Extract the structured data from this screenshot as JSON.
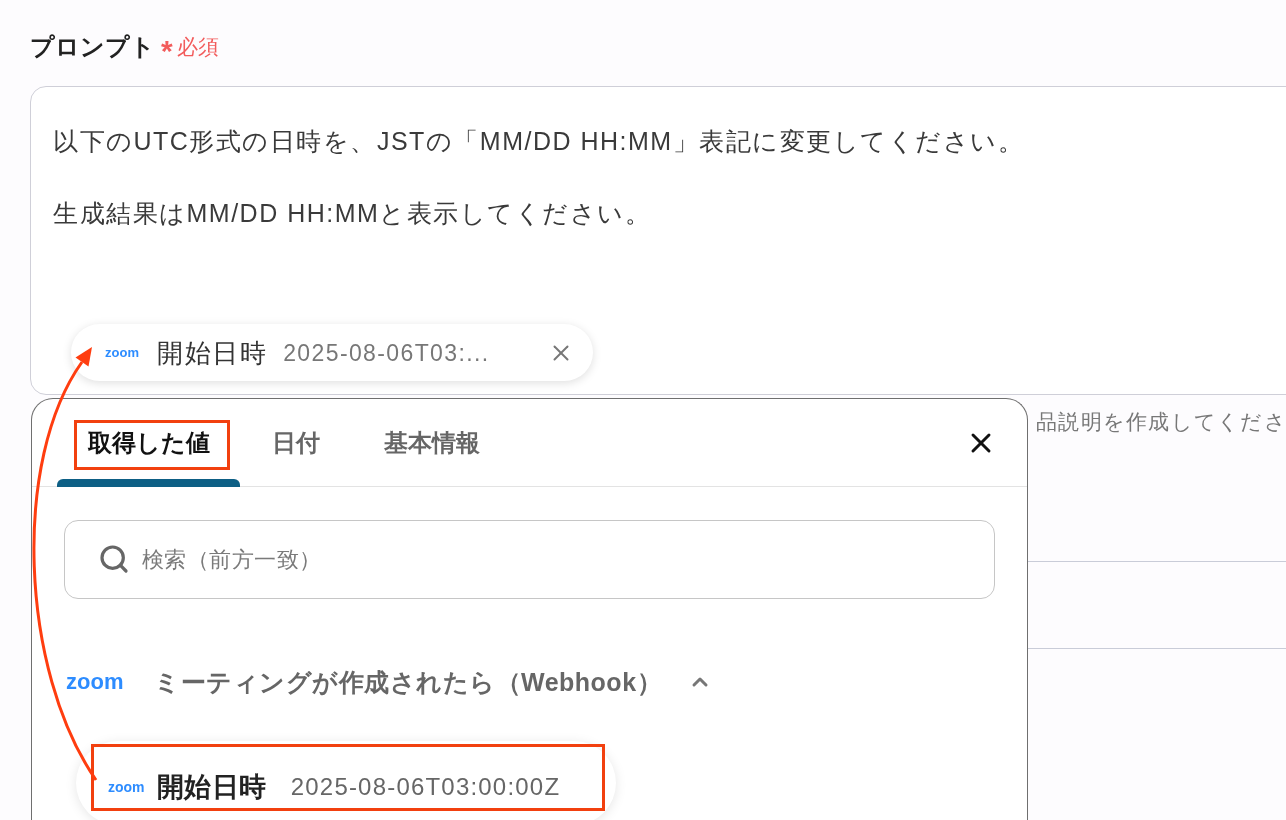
{
  "prompt": {
    "label": "プロンプト",
    "required_mark": "*",
    "required_text": "必須",
    "lines": [
      "以下のUTC形式の日時を、JSTの「MM/DD HH:MM」表記に変更してください。",
      "生成結果はMM/DD HH:MMと表示してください。"
    ],
    "variable_chip": {
      "logo": "zoom",
      "label": "開始日時",
      "value": "2025-08-06T03:..."
    }
  },
  "background_field": {
    "text": "品説明を作成してくださ"
  },
  "picker": {
    "tabs": [
      {
        "label": "取得した値",
        "selected": true,
        "highlighted": true
      },
      {
        "label": "日付",
        "selected": false,
        "highlighted": false
      },
      {
        "label": "基本情報",
        "selected": false,
        "highlighted": false
      }
    ],
    "search": {
      "placeholder": "検索（前方一致）"
    },
    "groups": [
      {
        "logo": "zoom",
        "title": "ミーティングが作成されたら（Webhook）",
        "expanded": true,
        "items": [
          {
            "logo": "zoom",
            "label": "開始日時",
            "value": "2025-08-06T03:00:00Z",
            "highlighted": true
          }
        ]
      }
    ]
  }
}
